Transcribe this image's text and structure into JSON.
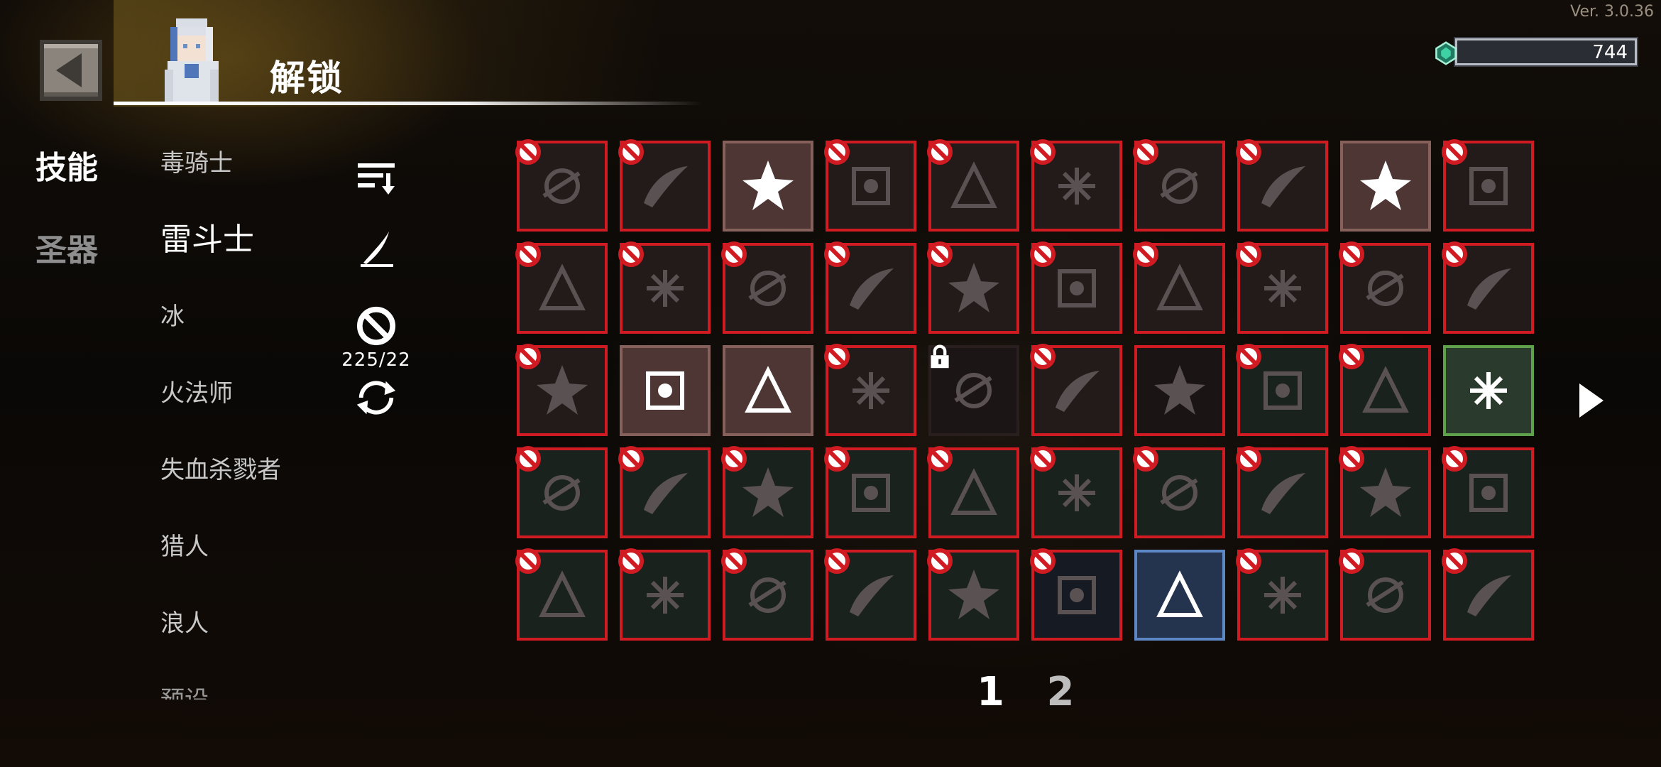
{
  "version": "Ver. 3.0.36",
  "header": {
    "title": "解锁"
  },
  "currency": {
    "value": "744",
    "gem_icon": "emerald-gem-icon",
    "gem_color": "#2fa585"
  },
  "tabs": [
    {
      "label": "技能",
      "active": true
    },
    {
      "label": "圣器",
      "active": false
    }
  ],
  "classes": [
    {
      "label": "毒骑士"
    },
    {
      "label": "雷斗士",
      "active": true
    },
    {
      "label": "冰"
    },
    {
      "label": "火法师"
    },
    {
      "label": "失血杀戮者"
    },
    {
      "label": "猎人"
    },
    {
      "label": "浪人"
    },
    {
      "label": "预设"
    }
  ],
  "tools": {
    "sort_icon": "sort-list-icon",
    "edit_icon": "quill-pen-icon",
    "ban_icon": "ban-icon",
    "ban_count": "225/22",
    "reset_icon": "refresh-cycle-icon"
  },
  "skills": [
    {
      "icon": "slash-arc-icon",
      "state": "banned"
    },
    {
      "icon": "curved-blade-icon",
      "state": "banned"
    },
    {
      "icon": "white-burst-flower-icon",
      "state": "unlocked"
    },
    {
      "icon": "spark-splatter-icon",
      "state": "banned"
    },
    {
      "icon": "hammer-up-arrow-icon",
      "state": "banned"
    },
    {
      "icon": "snowflake-orb-icon",
      "state": "banned"
    },
    {
      "icon": "flame-orb-icon",
      "state": "banned"
    },
    {
      "icon": "dark-vortex-icon",
      "state": "banned"
    },
    {
      "icon": "triple-spear-icon",
      "state": "unlocked"
    },
    {
      "icon": "mist-skull-icon",
      "state": "banned"
    },
    {
      "icon": "crescent-claw-icon",
      "state": "banned"
    },
    {
      "icon": "scales-icon",
      "state": "banned"
    },
    {
      "icon": "shell-icon",
      "state": "banned"
    },
    {
      "icon": "crosshair-spark-icon",
      "state": "banned"
    },
    {
      "icon": "frost-sword-icon",
      "state": "banned"
    },
    {
      "icon": "spiral-icon",
      "state": "banned"
    },
    {
      "icon": "target-orb-icon",
      "state": "banned"
    },
    {
      "icon": "thorn-branch-icon",
      "state": "banned"
    },
    {
      "icon": "smoke-cloud-icon",
      "state": "banned"
    },
    {
      "icon": "gauntlet-icon",
      "state": "banned"
    },
    {
      "icon": "ring-crack-icon",
      "state": "banned"
    },
    {
      "icon": "triple-claw-slash-icon",
      "state": "unlocked"
    },
    {
      "icon": "lightning-orb-icon",
      "state": "unlocked"
    },
    {
      "icon": "claw-scratch-icon",
      "state": "banned"
    },
    {
      "icon": "wind-spear-icon",
      "state": "locked"
    },
    {
      "icon": "cross-blade-icon",
      "state": "banned"
    },
    {
      "icon": "spike-wave-icon",
      "state": "plain"
    },
    {
      "icon": "impact-splash-icon",
      "state": "banned"
    },
    {
      "icon": "chain-link-icon",
      "state": "banned"
    },
    {
      "icon": "lightning-shatter-icon",
      "state": "selected-green"
    },
    {
      "icon": "fountain-icon",
      "state": "banned"
    },
    {
      "icon": "fire-ring-icon",
      "state": "banned"
    },
    {
      "icon": "skull-burst-icon",
      "state": "banned"
    },
    {
      "icon": "biohazard-icon",
      "state": "banned"
    },
    {
      "icon": "pierce-beam-icon",
      "state": "banned"
    },
    {
      "icon": "fire-bomb-icon",
      "state": "banned"
    },
    {
      "icon": "hook-slash-icon",
      "state": "banned"
    },
    {
      "icon": "dagger-rain-icon",
      "state": "banned"
    },
    {
      "icon": "winged-skull-icon",
      "state": "banned"
    },
    {
      "icon": "web-crack-icon",
      "state": "banned"
    },
    {
      "icon": "dust-spray-icon",
      "state": "banned"
    },
    {
      "icon": "fang-icon",
      "state": "banned"
    },
    {
      "icon": "shuriken-icon",
      "state": "banned"
    },
    {
      "icon": "gear-ring-icon",
      "state": "banned"
    },
    {
      "icon": "streak-slash-icon",
      "state": "banned"
    },
    {
      "icon": "hex-shield-icon",
      "state": "banned"
    },
    {
      "icon": "ghost-flame-icon",
      "state": "selected-blue"
    },
    {
      "icon": "hourglass-up-icon",
      "state": "banned"
    },
    {
      "icon": "boot-up-icon",
      "state": "banned"
    },
    {
      "icon": "sword-up-icon",
      "state": "banned"
    }
  ],
  "pagination": {
    "pages": [
      "1",
      "2"
    ],
    "active": "1"
  }
}
